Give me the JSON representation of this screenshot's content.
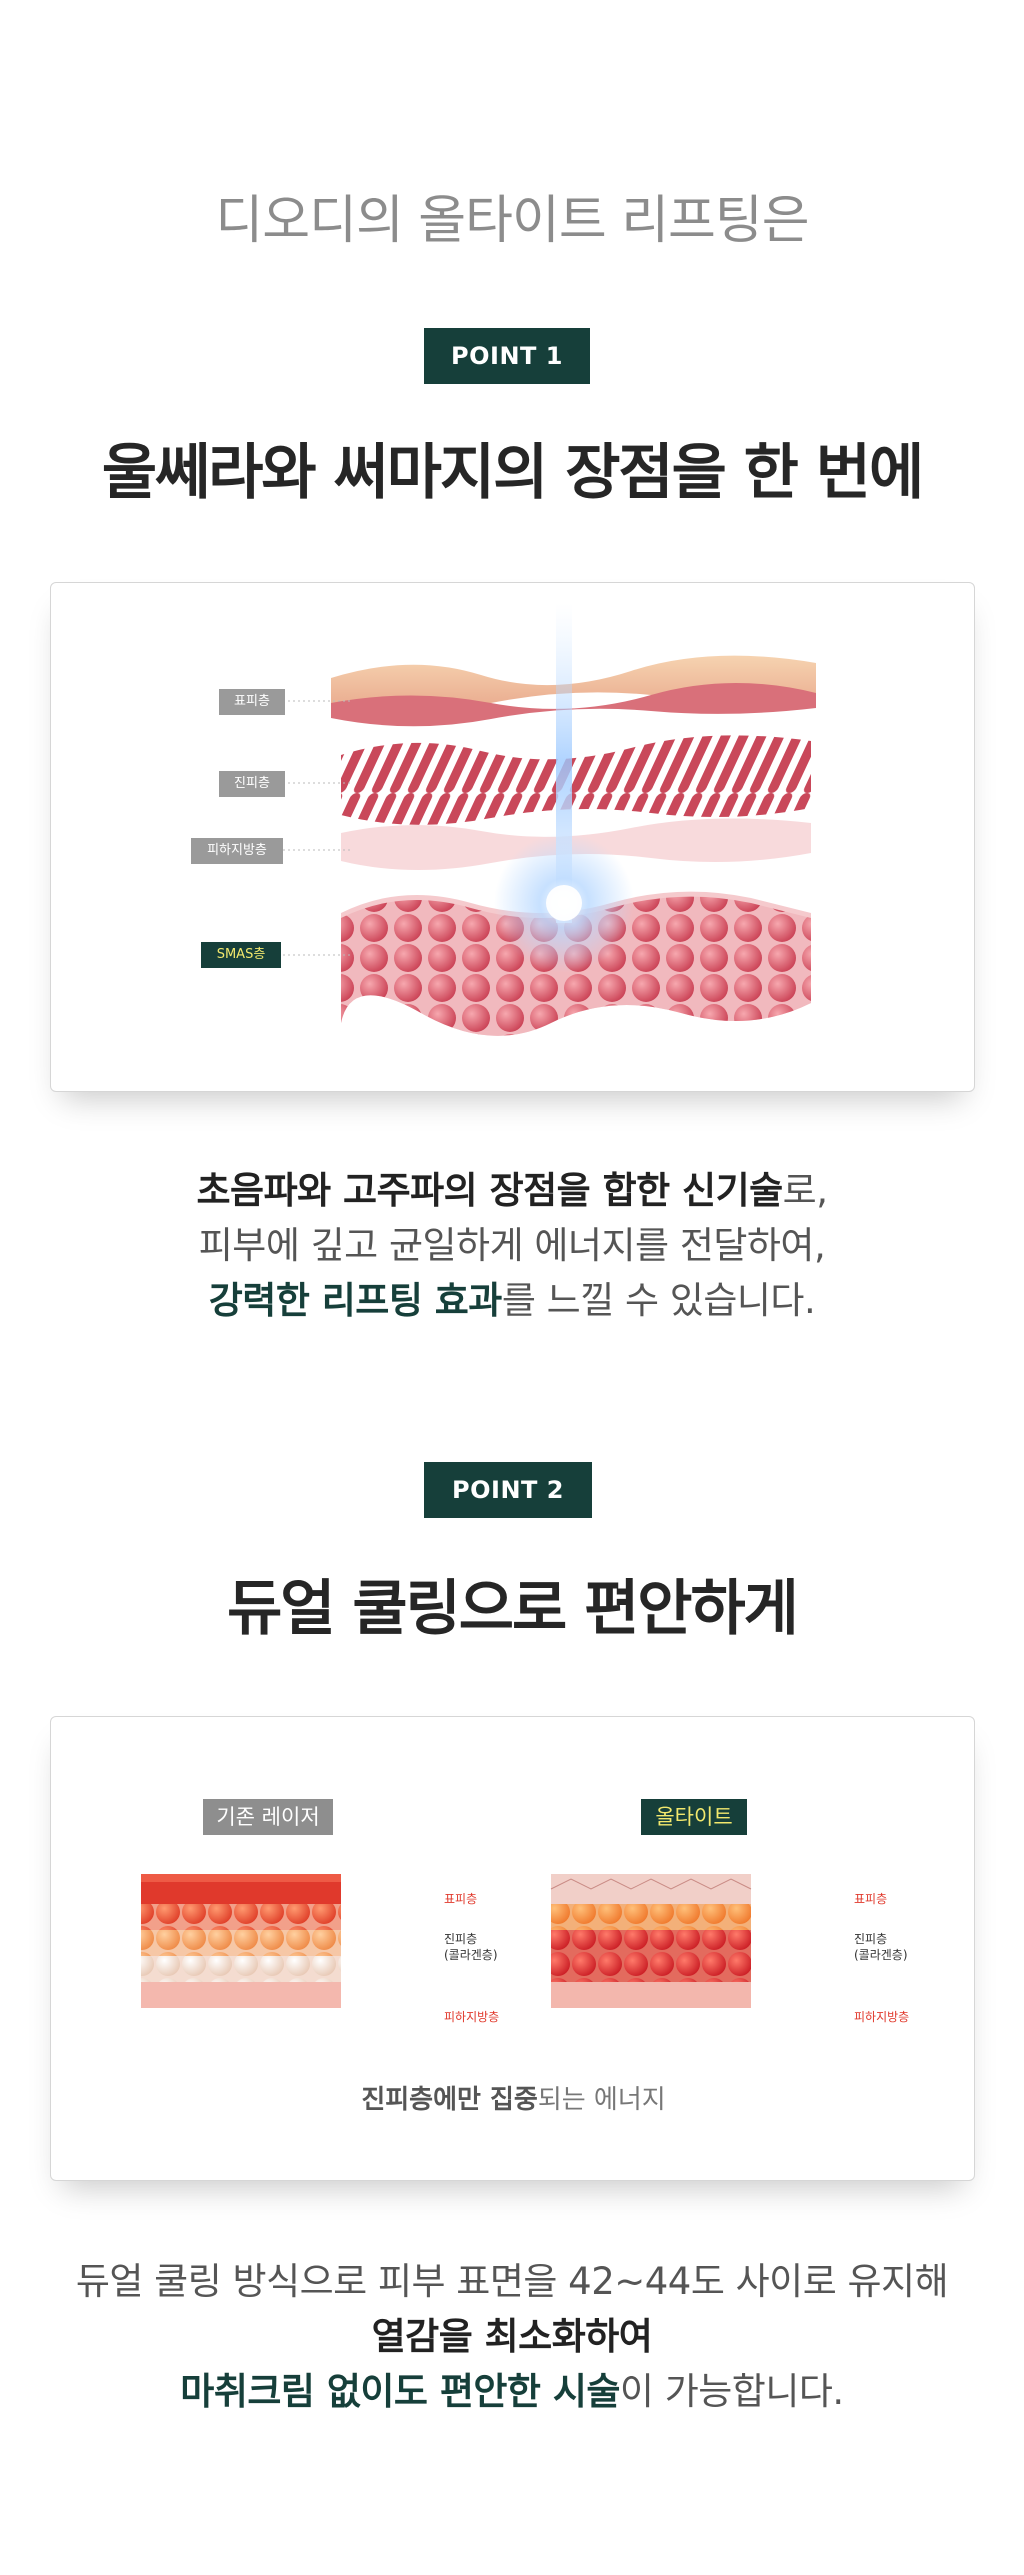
{
  "intro": "디오디의 올타이트 리프팅은",
  "point1": {
    "badge": "POINT 1",
    "title": "울쎄라와 써마지의 장점을 한 번에",
    "layers": {
      "epidermis": "표피층",
      "dermis": "진피층",
      "fat": "피하지방층",
      "smas": "SMAS층"
    },
    "desc": {
      "line1_bold": "초음파와 고주파의 장점을 합한 신기술",
      "line1_rest": "로,",
      "line2": "피부에 깊고 균일하게 에너지를 전달하여,",
      "line3_green": "강력한 리프팅 효과",
      "line3_rest": "를 느낄 수 있습니다."
    }
  },
  "point2": {
    "badge": "POINT 2",
    "title": "듀얼 쿨링으로 편안하게",
    "compare": {
      "left_label": "기존 레이저",
      "right_label": "올타이트",
      "epidermis": "표피층",
      "dermis": "진피층",
      "collagen": "(콜라겐층)",
      "fat": "피하지방층",
      "caption_bold": "진피층에만 집중",
      "caption_rest": "되는 에너지"
    },
    "desc": {
      "line1": "듀얼 쿨링 방식으로 피부 표면을 42~44도 사이로 유지해",
      "line2_bold": "열감을 최소화하여",
      "line3_green": "마취크림 없이도 편안한 시술",
      "line3_rest": "이 가능합니다."
    }
  },
  "colors": {
    "brand_dark_green": "#163f3a",
    "highlight_yellow": "#f2e86d",
    "tag_gray": "#9a9a9a"
  }
}
